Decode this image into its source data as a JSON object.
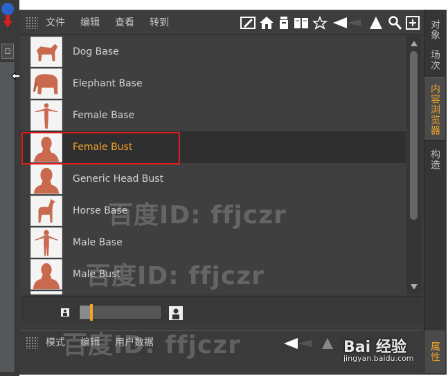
{
  "menubar": {
    "items": [
      "文件",
      "编辑",
      "查看",
      "转到"
    ]
  },
  "list": {
    "items": [
      {
        "label": "Dog Base",
        "thumb": "dog"
      },
      {
        "label": "Elephant Base",
        "thumb": "elephant"
      },
      {
        "label": "Female Base",
        "thumb": "figure"
      },
      {
        "label": "Female Bust",
        "thumb": "bust",
        "selected": true
      },
      {
        "label": "Generic Head Bust",
        "thumb": "bust"
      },
      {
        "label": "Horse Base",
        "thumb": "horse"
      },
      {
        "label": "Male Base",
        "thumb": "figure"
      },
      {
        "label": "Male Bust",
        "thumb": "bust"
      }
    ]
  },
  "bottombar": {
    "items": [
      "模式",
      "编辑",
      "用户数据"
    ]
  },
  "right_tabs": [
    "对象",
    "场次",
    "内容浏览器",
    "构造"
  ],
  "right_tab_bottom": "属性",
  "watermark": {
    "text": "百度ID: ffjczr",
    "logo": "Bai 经验",
    "url": "jingyan.baidu.com"
  },
  "colors": {
    "accent": "#f0a428",
    "highlight_border": "#e21c1c",
    "thumb_model": "#c96a4f"
  }
}
